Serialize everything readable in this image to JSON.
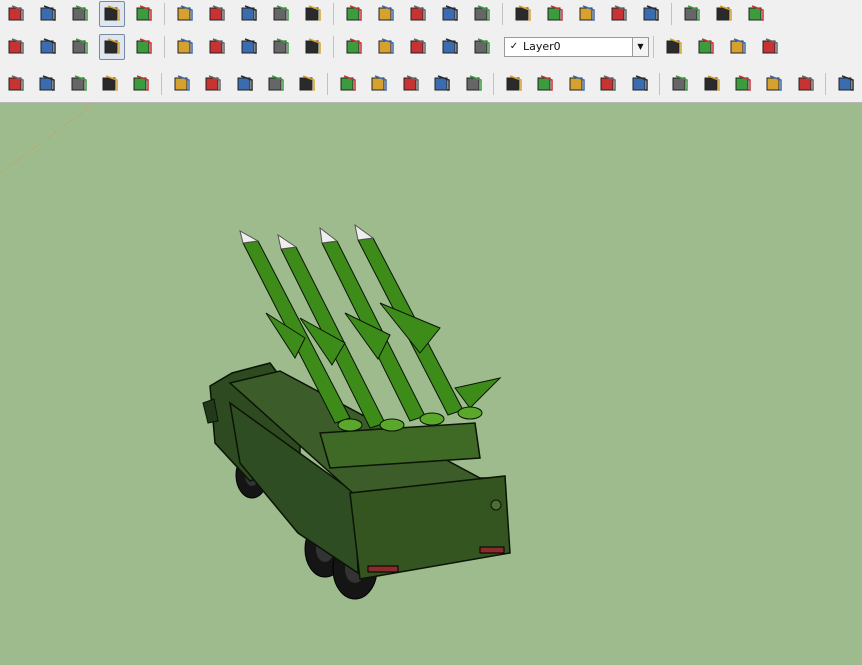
{
  "layers": {
    "current": "Layer0",
    "check": "✓",
    "arrow": "▼"
  },
  "colors": {
    "viewport_background": "#9dbb8d",
    "model_green": "#2d4a1f",
    "missile_green": "#3d8c1a",
    "toolbar_background": "#f0f0f0"
  },
  "toolbar_row1_icons": [
    "cube-outline-icon",
    "face-icon",
    "box-icon",
    "shaded-box-icon",
    "striped-box-icon",
    "textured-box-icon",
    "map-icon",
    "eraser-icon",
    "down-arrow-icon",
    "red-push-icon",
    "red-up-icon",
    "gray-lamp-icon",
    "paint-bucket-icon",
    "compass-icon",
    "section-plane-icon",
    "blue-cube-icon",
    "blue-cube-2-icon",
    "group-icon",
    "cubes-icon",
    "cubes-2-icon",
    "cubes-3-icon",
    "cubes-4-icon",
    "cubes-5-icon"
  ],
  "toolbar_row2_icons": [
    "pencil-icon",
    "text-icon",
    "paint-icon",
    "orbit-icon",
    "pan-hand-icon",
    "zoom-icon",
    "zoom-extents-icon",
    "warehouse-get-icon",
    "warehouse-share-icon",
    "export-icon",
    "ruby-icon",
    "user-icon",
    "push-up-icon",
    "layers-up-icon",
    "layers-vertical-icon",
    "logo-icon",
    "play-icon",
    "stop-icon",
    "scene-icon"
  ],
  "toolbar_row3_icons": [
    "arc-icon",
    "stair-icon",
    "triangle-icon",
    "columns-icon",
    "grid-icon",
    "hand-cage-icon",
    "curve-icon",
    "arrow-cone-icon",
    "stack-icon",
    "diagonal-icon",
    "steps-icon",
    "steps-2-icon",
    "branch-icon",
    "helix-icon",
    "hatch-icon",
    "corner-icon",
    "chair-icon",
    "hatch-2-icon",
    "hatch-3-icon",
    "layers-icon",
    "columns-2-icon",
    "stairs-3d-icon",
    "stairs-3d-2-icon",
    "slats-icon",
    "louver-icon",
    "cube-wire-icon"
  ]
}
